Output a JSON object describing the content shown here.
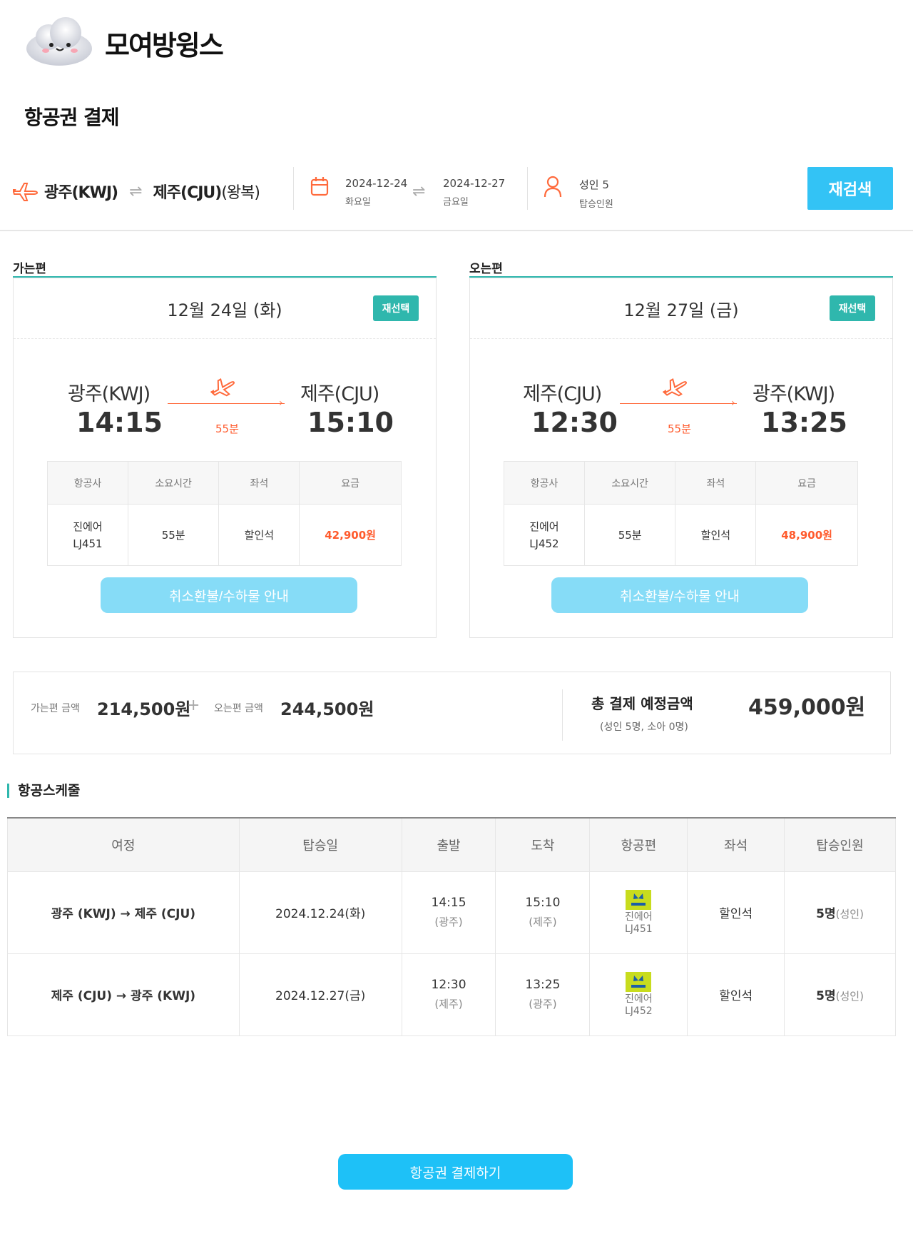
{
  "brand": {
    "name": "모여방윙스"
  },
  "page_title": "항공권 결제",
  "search": {
    "origin": "광주(KWJ)",
    "destination": "제주(CJU)",
    "trip_type": "(왕복)",
    "depart_date": "2024-12-24",
    "depart_day": "화요일",
    "return_date": "2024-12-27",
    "return_day": "금요일",
    "pax": "성인 5",
    "pax_label": "탑승인원",
    "re_search_label": "재검색"
  },
  "columns_label": {
    "airline": "항공사",
    "duration": "소요시간",
    "seat": "좌석",
    "fare": "요금"
  },
  "outbound": {
    "leg_label": "가는편",
    "date": "12월 24일 (화)",
    "reselect": "재선택",
    "from_city": "광주(KWJ)",
    "from_time": "14:15",
    "to_city": "제주(CJU)",
    "to_time": "15:10",
    "duration": "55분",
    "airline": "진에어",
    "flight": "LJ451",
    "seat": "할인석",
    "fare": "42,900원",
    "refund_label": "취소환불/수하물 안내"
  },
  "inbound": {
    "leg_label": "오는편",
    "date": "12월 27일 (금)",
    "reselect": "재선택",
    "from_city": "제주(CJU)",
    "from_time": "12:30",
    "to_city": "광주(KWJ)",
    "to_time": "13:25",
    "duration": "55분",
    "airline": "진에어",
    "flight": "LJ452",
    "seat": "할인석",
    "fare": "48,900원",
    "refund_label": "취소환불/수하물 안내"
  },
  "summary": {
    "out_label": "가는편 금액",
    "out_amount": "214,500원",
    "plus": "+",
    "in_label": "오는편 금액",
    "in_amount": "244,500원",
    "total_label": "총 결제 예정금액",
    "total_note": "(성인 5명, 소아 0명)",
    "total_amount": "459,000원"
  },
  "schedule": {
    "title": "항공스케줄",
    "headers": [
      "여정",
      "탑승일",
      "출발",
      "도착",
      "항공편",
      "좌석",
      "탑승인원"
    ],
    "rows": [
      {
        "route": "광주 (KWJ) → 제주 (CJU)",
        "date": "2024.12.24(화)",
        "dep_time": "14:15",
        "dep_city": "(광주)",
        "arr_time": "15:10",
        "arr_city": "(제주)",
        "airline": "진에어",
        "flight": "LJ451",
        "seat": "할인석",
        "pax": "5명",
        "pax_type": "(성인)"
      },
      {
        "route": "제주 (CJU) → 광주 (KWJ)",
        "date": "2024.12.27(금)",
        "dep_time": "12:30",
        "dep_city": "(제주)",
        "arr_time": "13:25",
        "arr_city": "(광주)",
        "airline": "진에어",
        "flight": "LJ452",
        "seat": "할인석",
        "pax": "5명",
        "pax_type": "(성인)"
      }
    ]
  },
  "pay_button": "항공권 결제하기",
  "colors": {
    "accent": "#33c3f5",
    "teal": "#2fb7ad",
    "price": "#ff5a2c",
    "refund": "#86dcf7"
  }
}
